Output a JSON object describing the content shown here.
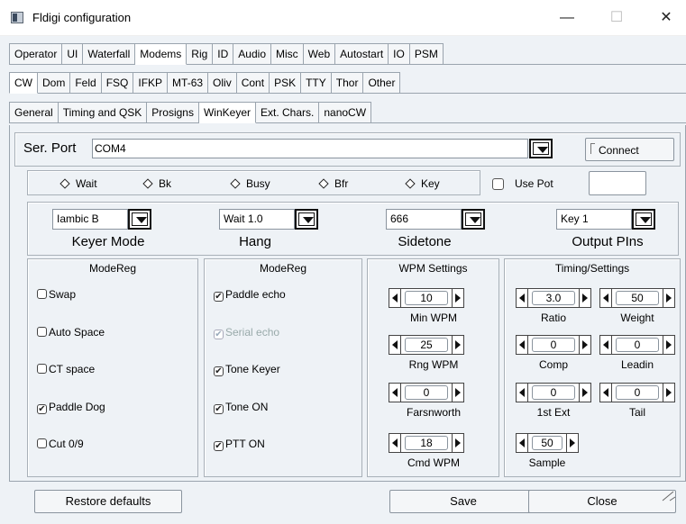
{
  "window": {
    "title": "Fldigi configuration",
    "minimize": "—",
    "maximize": "☐",
    "close": "✕"
  },
  "tabs1": [
    "Operator",
    "UI",
    "Waterfall",
    "Modems",
    "Rig",
    "ID",
    "Audio",
    "Misc",
    "Web",
    "Autostart",
    "IO",
    "PSM"
  ],
  "tabs2": [
    "CW",
    "Dom",
    "Feld",
    "FSQ",
    "IFKP",
    "MT-63",
    "Oliv",
    "Cont",
    "PSK",
    "TTY",
    "Thor",
    "Other"
  ],
  "tabs3": [
    "General",
    "Timing and QSK",
    "Prosigns",
    "WinKeyer",
    "Ext. Chars.",
    "nanoCW"
  ],
  "serial": {
    "label": "Ser. Port",
    "value": "COM4",
    "connect": "Connect"
  },
  "flags": [
    "Wait",
    "Bk",
    "Busy",
    "Bfr",
    "Key"
  ],
  "use_pot": "Use Pot",
  "use_pot_value": "",
  "choices": [
    {
      "value": "Iambic B",
      "label": "Keyer Mode"
    },
    {
      "value": "Wait 1.0",
      "label": "Hang"
    },
    {
      "value": "666",
      "label": "Sidetone"
    },
    {
      "value": "Key 1",
      "label": "Output PIns"
    }
  ],
  "modereg1": {
    "title": "ModeReg",
    "items": [
      {
        "label": "Swap",
        "checked": false
      },
      {
        "label": "Auto Space",
        "checked": false
      },
      {
        "label": "CT space",
        "checked": false
      },
      {
        "label": "Paddle Dog",
        "checked": true
      },
      {
        "label": "Cut 0/9",
        "checked": false
      }
    ]
  },
  "modereg2": {
    "title": "ModeReg",
    "items": [
      {
        "label": "Paddle echo",
        "checked": true
      },
      {
        "label": "Serial echo",
        "checked": true,
        "disabled": true
      },
      {
        "label": "Tone Keyer",
        "checked": true
      },
      {
        "label": "Tone ON",
        "checked": true
      },
      {
        "label": "PTT ON",
        "checked": true
      }
    ]
  },
  "wpm": {
    "title": "WPM Settings",
    "items": [
      {
        "value": "10",
        "label": "Min WPM"
      },
      {
        "value": "25",
        "label": "Rng WPM"
      },
      {
        "value": "0",
        "label": "Farsnworth"
      },
      {
        "value": "18",
        "label": "Cmd WPM"
      }
    ]
  },
  "timing": {
    "title": "Timing/Settings",
    "items": [
      {
        "value": "3.0",
        "label": "Ratio"
      },
      {
        "value": "50",
        "label": "Weight"
      },
      {
        "value": "0",
        "label": "Comp"
      },
      {
        "value": "0",
        "label": "Leadin"
      },
      {
        "value": "0",
        "label": "1st Ext"
      },
      {
        "value": "0",
        "label": "Tail"
      },
      {
        "value": "50",
        "label": "Sample"
      }
    ]
  },
  "buttons": {
    "restore": "Restore defaults",
    "save": "Save",
    "close": "Close"
  }
}
